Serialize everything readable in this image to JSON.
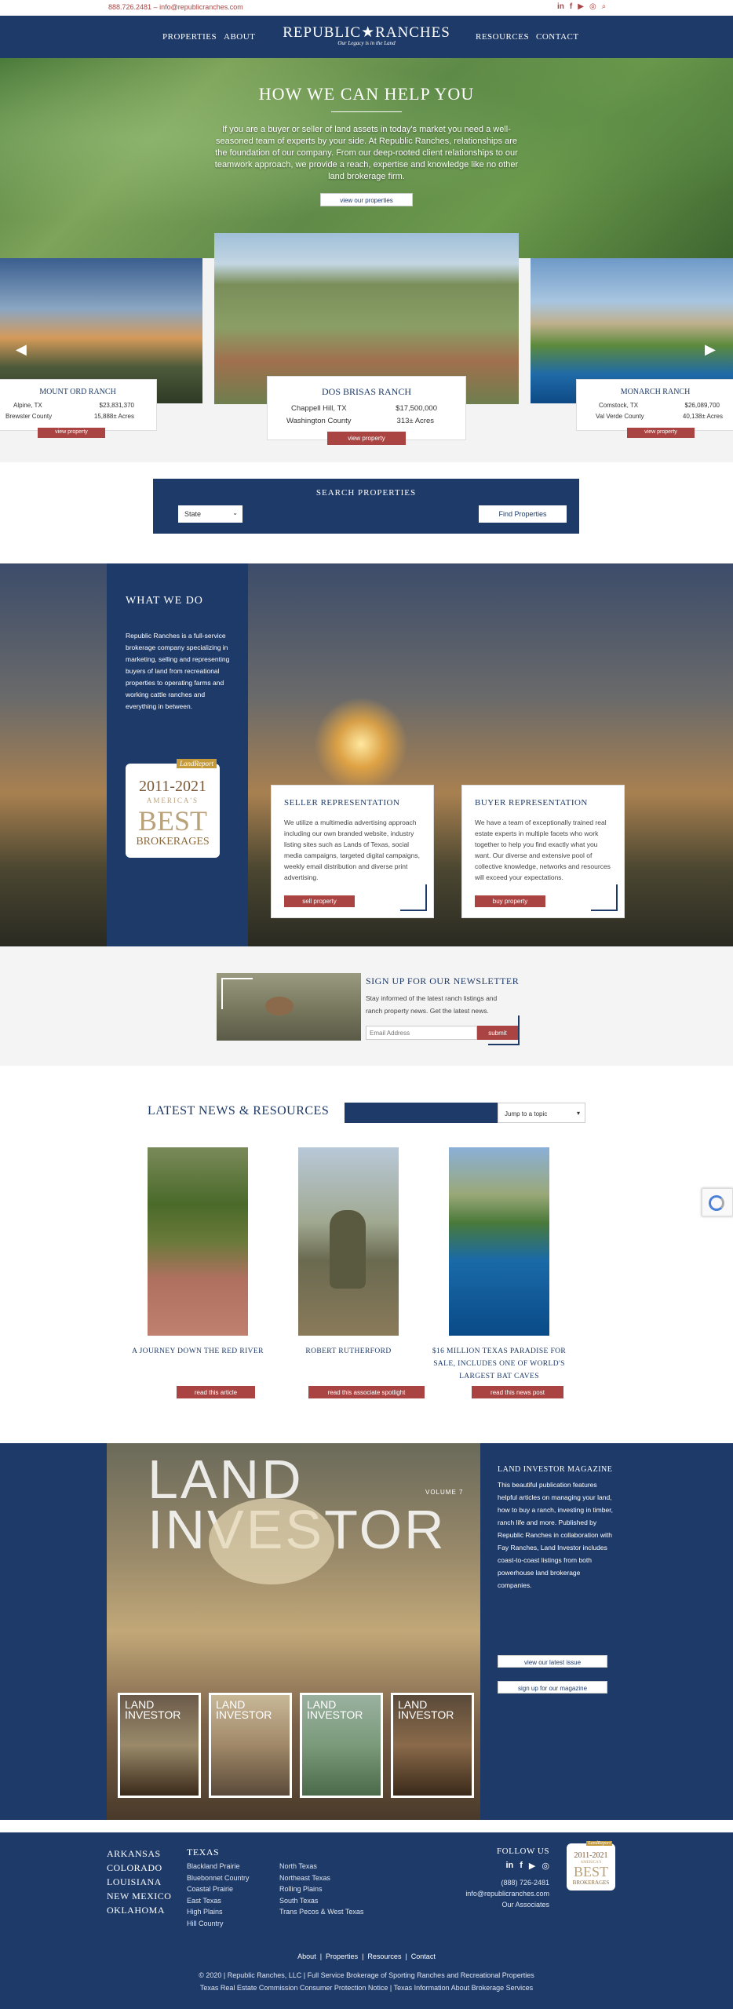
{
  "topbar": {
    "phone": "888.726.2481",
    "sep": "–",
    "email": "info@republicranches.com"
  },
  "header": {
    "nav_left": [
      "PROPERTIES",
      "ABOUT"
    ],
    "logo": "REPUBLIC★RANCHES",
    "logo_tagline": "Our Legacy is in the Land",
    "nav_right": [
      "RESOURCES",
      "CONTACT"
    ]
  },
  "hero": {
    "title": "HOW WE CAN HELP YOU",
    "body": "If you are a buyer or seller of land assets in today's market you need a well-seasoned team of experts by your side. At Republic Ranches, relationships are the foundation of our company. From our deep-rooted client relationships to our teamwork approach, we provide a reach, expertise and knowledge like no other land brokerage firm.",
    "button": "view our properties"
  },
  "carousel": {
    "left": {
      "name": "MOUNT ORD RANCH",
      "location": "Alpine, TX",
      "price": "$23,831,370",
      "county": "Brewster County",
      "acres": "15,888± Acres",
      "button": "view property"
    },
    "center": {
      "name": "DOS BRISAS RANCH",
      "location": "Chappell Hill, TX",
      "price": "$17,500,000",
      "county": "Washington County",
      "acres": "313± Acres",
      "button": "view property"
    },
    "right": {
      "name": "MONARCH RANCH",
      "location": "Comstock, TX",
      "price": "$26,089,700",
      "county": "Val Verde County",
      "acres": "40,138± Acres",
      "button": "view property"
    }
  },
  "search": {
    "title": "SEARCH PROPERTIES",
    "state_value": "State",
    "find_button": "Find Properties"
  },
  "what_we_do": {
    "title": "WHAT WE DO",
    "body": "Republic Ranches is a full-service brokerage company specializing in marketing, selling and representing buyers of land from recreational properties to operating farms and working cattle ranches and everything in between.",
    "badge": {
      "brand": "LandReport",
      "years": "2011-2021",
      "line1": "AMERICA'S",
      "line2": "BEST",
      "line3": "BROKERAGES"
    },
    "seller": {
      "title": "SELLER REPRESENTATION",
      "body": "We utilize a multimedia advertising approach including our own branded website, industry listing sites such as Lands of Texas, social media campaigns, targeted digital campaigns, weekly email distribution and diverse print advertising.",
      "button": "sell property"
    },
    "buyer": {
      "title": "BUYER REPRESENTATION",
      "body": "We have a team of exceptionally trained real estate experts in multiple facets who work together to help you find exactly what you want. Our diverse and extensive pool of collective knowledge, networks and resources will exceed your expectations.",
      "button": "buy property"
    }
  },
  "newsletter": {
    "title": "SIGN UP FOR OUR NEWSLETTER",
    "body": "Stay informed of the latest ranch listings and ranch property news. Get the latest news.",
    "placeholder": "Email Address",
    "button": "submit"
  },
  "latest": {
    "title": "LATEST NEWS & RESOURCES",
    "dropdown": "Jump to a topic",
    "items": [
      {
        "title": "A JOURNEY DOWN THE RED RIVER",
        "button": "read this article"
      },
      {
        "title": "ROBERT RUTHERFORD",
        "button": "read this associate spotlight"
      },
      {
        "title": "$16 MILLION TEXAS PARADISE FOR SALE, INCLUDES ONE OF WORLD'S LARGEST BAT CAVES",
        "button": "read this news post"
      }
    ]
  },
  "magazine": {
    "cover_title": "LAND INVESTOR",
    "cover_volume": "VOLUME 7",
    "thumb_label": "LAND INVESTOR",
    "title": "LAND INVESTOR MAGAZINE",
    "body": "This beautiful publication features helpful articles on managing your land, how to buy a ranch, investing in timber, ranch life and more. Published by Republic Ranches in collaboration with Fay Ranches, Land Investor includes coast-to-coast listings from both powerhouse land brokerage companies.",
    "btn1": "view our latest issue",
    "btn2": "sign up for our magazine"
  },
  "footer": {
    "states": [
      "ARKANSAS",
      "COLORADO",
      "LOUISIANA",
      "NEW MEXICO",
      "OKLAHOMA"
    ],
    "texas_title": "TEXAS",
    "texas_col1": [
      "Blackland Prairie",
      "Bluebonnet Country",
      "Coastal Prairie",
      "East Texas",
      "High Plains",
      "Hill Country"
    ],
    "texas_col2": [
      "North Texas",
      "Northeast Texas",
      "Rolling Plains",
      "South Texas",
      "Trans Pecos & West Texas"
    ],
    "follow": "FOLLOW US",
    "phone": "(888) 726-2481",
    "email": "info@republicranches.com",
    "associates": "Our Associates",
    "links": [
      "About",
      "Properties",
      "Resources",
      "Contact"
    ],
    "copyright": "© 2020 | Republic Ranches, LLC | Full Service Brokerage of Sporting Ranches and Recreational Properties",
    "notice": "Texas Real Estate Commission Consumer Protection Notice | Texas Information About Brokerage Services"
  },
  "colors": {
    "navy": "#1e3a68",
    "red": "#a94442"
  }
}
